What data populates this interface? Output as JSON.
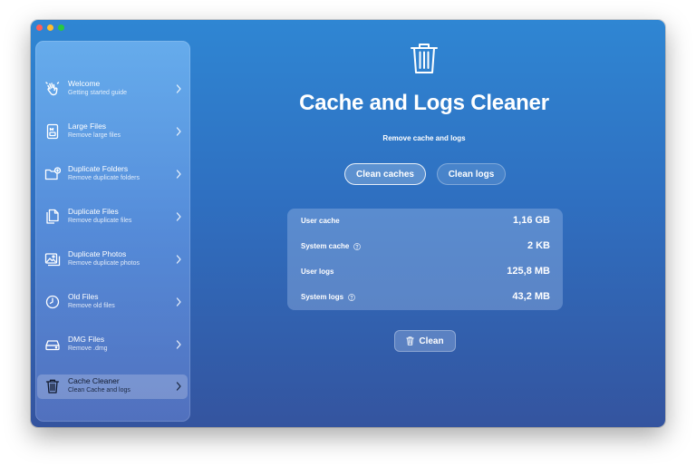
{
  "window": {
    "traffic_lights": [
      "close",
      "minimize",
      "maximize"
    ]
  },
  "sidebar": {
    "items": [
      {
        "title": "Welcome",
        "subtitle": "Getting started guide",
        "icon": "hand-wave-icon"
      },
      {
        "title": "Large Files",
        "subtitle": "Remove large files",
        "icon": "large-file-icon"
      },
      {
        "title": "Duplicate Folders",
        "subtitle": "Remove duplicate folders",
        "icon": "folder-plus-icon"
      },
      {
        "title": "Duplicate Files",
        "subtitle": "Remove duplicate files",
        "icon": "documents-icon"
      },
      {
        "title": "Duplicate Photos",
        "subtitle": "Remove duplicate photos",
        "icon": "photos-icon"
      },
      {
        "title": "Old Files",
        "subtitle": "Remove old files",
        "icon": "clock-icon"
      },
      {
        "title": "DMG Files",
        "subtitle": "Remove .dmg",
        "icon": "disk-drive-icon"
      },
      {
        "title": "Cache Cleaner",
        "subtitle": "Clean Cache and logs",
        "icon": "trash-icon"
      }
    ],
    "active_index": 7
  },
  "main": {
    "icon": "trash-icon",
    "title": "Cache and Logs Cleaner",
    "subtitle": "Remove cache and logs",
    "buttons": {
      "clean_caches": "Clean caches",
      "clean_logs": "Clean logs"
    },
    "stats": [
      {
        "label": "User cache",
        "value": "1,16 GB",
        "help": false
      },
      {
        "label": "System cache",
        "value": "2 KB",
        "help": true
      },
      {
        "label": "User logs",
        "value": "125,8 MB",
        "help": false
      },
      {
        "label": "System logs",
        "value": "43,2 MB",
        "help": true
      }
    ],
    "clean_button": "Clean"
  },
  "colors": {
    "window_gradient_top": "#2f86d3",
    "window_gradient_bottom": "#34549f",
    "text": "#ffffff"
  }
}
